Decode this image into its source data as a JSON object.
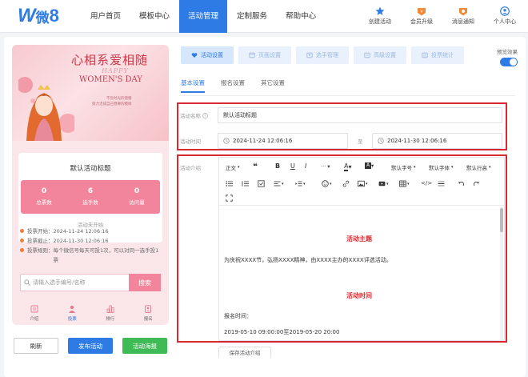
{
  "brand": {
    "logo_w": "W",
    "logo_cn": "微",
    "logo_num": "8"
  },
  "nav": {
    "items": [
      "用户首页",
      "模板中心",
      "活动管理",
      "定制服务",
      "帮助中心"
    ],
    "active": 2
  },
  "top_icons": [
    {
      "label": "创建活动",
      "icon": "star-icon"
    },
    {
      "label": "会员升级",
      "icon": "vip-icon"
    },
    {
      "label": "消息通知",
      "icon": "bell-icon"
    },
    {
      "label": "个人中心",
      "icon": "user-icon"
    }
  ],
  "preview": {
    "banner": {
      "title": "心相系爱相随",
      "en1": "HAPPY",
      "en2": "WOMEN'S DAY",
      "slogan1": "不负时光的馈赠",
      "slogan2": "努力活成自己想要的模样"
    },
    "activity_title": "默认活动标题",
    "stats": [
      {
        "value": "0",
        "label": "总票数"
      },
      {
        "value": "6",
        "label": "选手数"
      },
      {
        "value": "0",
        "label": "访问量"
      }
    ],
    "status": "活动未开始",
    "info": [
      {
        "label": "投票开始：",
        "value": "2024-11-24 12:06:16"
      },
      {
        "label": "投票截止：",
        "value": "2024-11-30 12:06:16"
      },
      {
        "label": "投票规则：",
        "value": "每个微信号每天可投1次，可以对同一选手投1票"
      }
    ],
    "search": {
      "placeholder": "请输入选手编号/名称",
      "button": "搜索"
    },
    "bottom_nav": [
      {
        "label": "介绍",
        "icon": "intro-icon"
      },
      {
        "label": "投票",
        "icon": "vote-icon"
      },
      {
        "label": "排行",
        "icon": "rank-icon"
      },
      {
        "label": "报名",
        "icon": "signup-icon"
      }
    ],
    "bottom_nav_active": 1
  },
  "actions": {
    "refresh": "刷新",
    "publish": "发布活动",
    "poster": "活动海报"
  },
  "panel_tabs": [
    "活动设置",
    "页面设置",
    "选手管理",
    "高级设置",
    "投票统计"
  ],
  "panel_tab_active": 0,
  "preview_toggle": {
    "label": "预览效果",
    "on": true
  },
  "sub_tabs": [
    "基本设置",
    "报名设置",
    "其它设置"
  ],
  "sub_tab_active": 0,
  "form": {
    "name_label": "活动名称",
    "name_value": "默认活动标题",
    "time_label": "活动时间",
    "start": "2024-11-24 12:06:16",
    "to": "至",
    "end": "2024-11-30 12:06:16",
    "intro_label": "活动介绍"
  },
  "toolbar": {
    "para": "正文",
    "fontsize": "默认字号",
    "fontfamily": "默认字体",
    "lineheight": "默认行高"
  },
  "editor": {
    "heading1": "活动主题",
    "p1": "为庆祝XXXX节，弘扬XXXX精神，由XXXX主办的XXXX评选活动。",
    "heading2": "活动时间",
    "p2": "报名时间：",
    "p3": "2019-05-10 09:00:00至2019-05-20 20:00"
  },
  "save_button": "保存活动介绍",
  "colors": {
    "accent": "#2f7be6",
    "pink": "#f2849b",
    "highlight_border": "#d9282f",
    "success": "#3fbb55"
  }
}
